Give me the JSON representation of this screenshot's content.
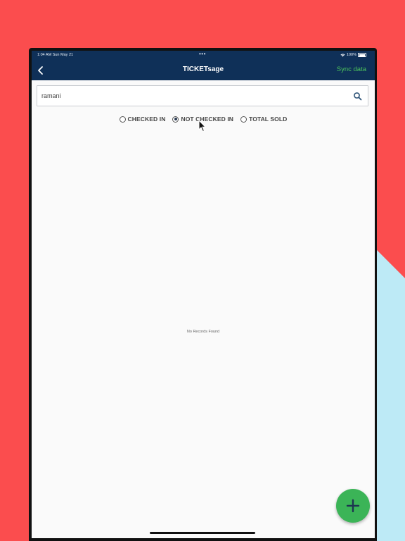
{
  "status_bar": {
    "time_date": "1:04 AM  Sun May 21",
    "dots": "•••",
    "battery_text": "100%"
  },
  "header": {
    "title": "TICKETsage",
    "sync_label": "Sync data"
  },
  "search": {
    "value": "ramani"
  },
  "filters": [
    {
      "label": "CHECKED IN",
      "selected": false
    },
    {
      "label": "NOT CHECKED IN",
      "selected": true
    },
    {
      "label": "TOTAL SOLD",
      "selected": false
    }
  ],
  "empty_message": "No Records Found",
  "colors": {
    "header_bg": "#0f3058",
    "sync_green": "#4cc35c",
    "fab_green": "#3bb457",
    "background_red": "#fb4d4e",
    "background_blue": "#bdeaf6"
  },
  "icons": {
    "back": "chevron-left-icon",
    "search": "search-icon",
    "fab": "plus-icon"
  }
}
